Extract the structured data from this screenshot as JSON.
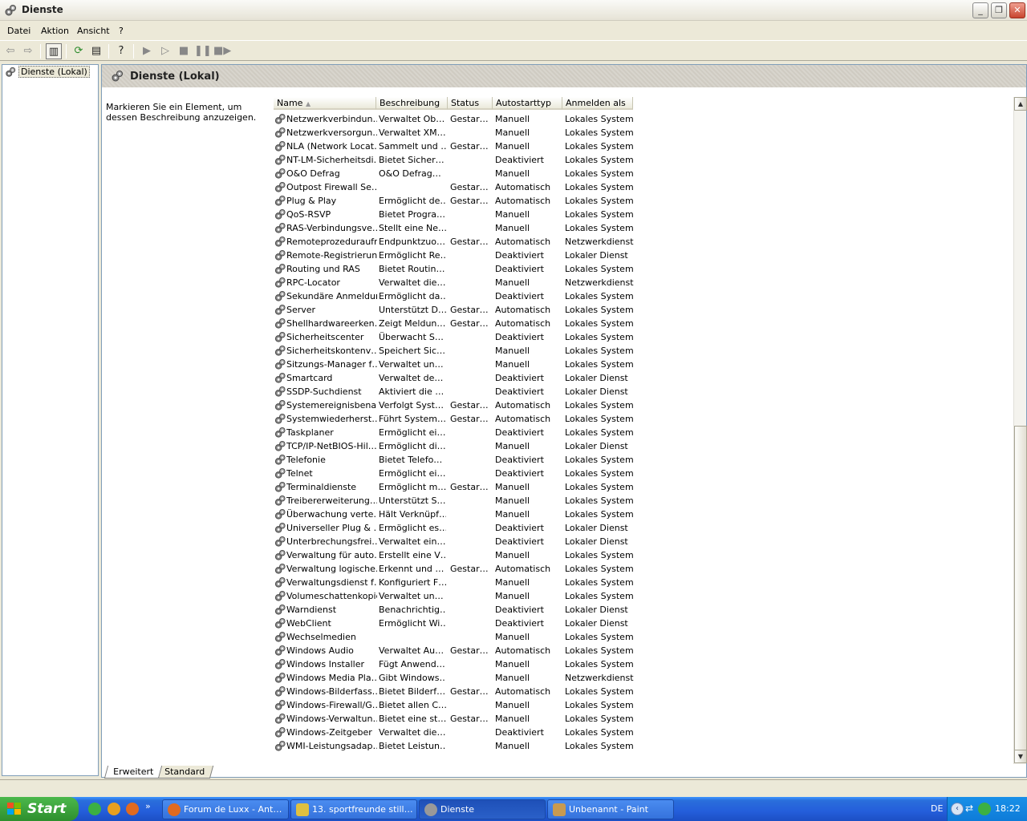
{
  "window": {
    "title": "Dienste",
    "controls": [
      "minimize",
      "maximize",
      "close"
    ]
  },
  "menu": [
    "Datei",
    "Aktion",
    "Ansicht",
    "?"
  ],
  "tree": {
    "root_label": "Dienste (Lokal)"
  },
  "pane": {
    "title": "Dienste (Lokal)",
    "description": "Markieren Sie ein Element, um dessen Beschreibung anzuzeigen."
  },
  "columns": [
    "Name",
    "Beschreibung",
    "Status",
    "Autostarttyp",
    "Anmelden als"
  ],
  "services": [
    [
      "Netzwerkverbindun…",
      "Verwaltet Ob…",
      "Gestar…",
      "Manuell",
      "Lokales System"
    ],
    [
      "Netzwerkversorgun…",
      "Verwaltet XM…",
      "",
      "Manuell",
      "Lokales System"
    ],
    [
      "NLA (Network Locat…",
      "Sammelt und …",
      "Gestar…",
      "Manuell",
      "Lokales System"
    ],
    [
      "NT-LM-Sicherheitsdi…",
      "Bietet Sicher…",
      "",
      "Deaktiviert",
      "Lokales System"
    ],
    [
      "O&O Defrag",
      "O&O Defrag…",
      "",
      "Manuell",
      "Lokales System"
    ],
    [
      "Outpost Firewall Se…",
      "",
      "Gestar…",
      "Automatisch",
      "Lokales System"
    ],
    [
      "Plug & Play",
      "Ermöglicht de…",
      "Gestar…",
      "Automatisch",
      "Lokales System"
    ],
    [
      "QoS-RSVP",
      "Bietet Progra…",
      "",
      "Manuell",
      "Lokales System"
    ],
    [
      "RAS-Verbindungsve…",
      "Stellt eine Ne…",
      "",
      "Manuell",
      "Lokales System"
    ],
    [
      "Remoteprozeduraufr…",
      "Endpunktzuo…",
      "Gestar…",
      "Automatisch",
      "Netzwerkdienst"
    ],
    [
      "Remote-Registrierung",
      "Ermöglicht Re…",
      "",
      "Deaktiviert",
      "Lokaler Dienst"
    ],
    [
      "Routing und RAS",
      "Bietet Routin…",
      "",
      "Deaktiviert",
      "Lokales System"
    ],
    [
      "RPC-Locator",
      "Verwaltet die…",
      "",
      "Manuell",
      "Netzwerkdienst"
    ],
    [
      "Sekundäre Anmeldung",
      "Ermöglicht da…",
      "",
      "Deaktiviert",
      "Lokales System"
    ],
    [
      "Server",
      "Unterstützt D…",
      "Gestar…",
      "Automatisch",
      "Lokales System"
    ],
    [
      "Shellhardwareerken…",
      "Zeigt Meldun…",
      "Gestar…",
      "Automatisch",
      "Lokales System"
    ],
    [
      "Sicherheitscenter",
      "Überwacht S…",
      "",
      "Deaktiviert",
      "Lokales System"
    ],
    [
      "Sicherheitskontenv…",
      "Speichert Sic…",
      "",
      "Manuell",
      "Lokales System"
    ],
    [
      "Sitzungs-Manager f…",
      "Verwaltet un…",
      "",
      "Manuell",
      "Lokales System"
    ],
    [
      "Smartcard",
      "Verwaltet de…",
      "",
      "Deaktiviert",
      "Lokaler Dienst"
    ],
    [
      "SSDP-Suchdienst",
      "Aktiviert die …",
      "",
      "Deaktiviert",
      "Lokaler Dienst"
    ],
    [
      "Systemereignisbena…",
      "Verfolgt Syst…",
      "Gestar…",
      "Automatisch",
      "Lokales System"
    ],
    [
      "Systemwiederherst…",
      "Führt System…",
      "Gestar…",
      "Automatisch",
      "Lokales System"
    ],
    [
      "Taskplaner",
      "Ermöglicht ei…",
      "",
      "Deaktiviert",
      "Lokales System"
    ],
    [
      "TCP/IP-NetBIOS-Hil…",
      "Ermöglicht di…",
      "",
      "Manuell",
      "Lokaler Dienst"
    ],
    [
      "Telefonie",
      "Bietet Telefo…",
      "",
      "Deaktiviert",
      "Lokales System"
    ],
    [
      "Telnet",
      "Ermöglicht ei…",
      "",
      "Deaktiviert",
      "Lokales System"
    ],
    [
      "Terminaldienste",
      "Ermöglicht m…",
      "Gestar…",
      "Manuell",
      "Lokales System"
    ],
    [
      "Treibererweiterung…",
      "Unterstützt S…",
      "",
      "Manuell",
      "Lokales System"
    ],
    [
      "Überwachung verte…",
      "Hält Verknüpf…",
      "",
      "Manuell",
      "Lokales System"
    ],
    [
      "Universeller Plug & …",
      "Ermöglicht es…",
      "",
      "Deaktiviert",
      "Lokaler Dienst"
    ],
    [
      "Unterbrechungsfrei…",
      "Verwaltet ein…",
      "",
      "Deaktiviert",
      "Lokaler Dienst"
    ],
    [
      "Verwaltung für auto…",
      "Erstellt eine V…",
      "",
      "Manuell",
      "Lokales System"
    ],
    [
      "Verwaltung logische…",
      "Erkennt und …",
      "Gestar…",
      "Automatisch",
      "Lokales System"
    ],
    [
      "Verwaltungsdienst f…",
      "Konfiguriert F…",
      "",
      "Manuell",
      "Lokales System"
    ],
    [
      "Volumeschattenkopie",
      "Verwaltet un…",
      "",
      "Manuell",
      "Lokales System"
    ],
    [
      "Warndienst",
      "Benachrichtig…",
      "",
      "Deaktiviert",
      "Lokaler Dienst"
    ],
    [
      "WebClient",
      "Ermöglicht Wi…",
      "",
      "Deaktiviert",
      "Lokaler Dienst"
    ],
    [
      "Wechselmedien",
      "",
      "",
      "Manuell",
      "Lokales System"
    ],
    [
      "Windows Audio",
      "Verwaltet Au…",
      "Gestar…",
      "Automatisch",
      "Lokales System"
    ],
    [
      "Windows Installer",
      "Fügt Anwend…",
      "",
      "Manuell",
      "Lokales System"
    ],
    [
      "Windows Media Pla…",
      "Gibt Windows…",
      "",
      "Manuell",
      "Netzwerkdienst"
    ],
    [
      "Windows-Bilderfass…",
      "Bietet Bilderf…",
      "Gestar…",
      "Automatisch",
      "Lokales System"
    ],
    [
      "Windows-Firewall/G…",
      "Bietet allen C…",
      "",
      "Manuell",
      "Lokales System"
    ],
    [
      "Windows-Verwaltun…",
      "Bietet eine st…",
      "Gestar…",
      "Manuell",
      "Lokales System"
    ],
    [
      "Windows-Zeitgeber",
      "Verwaltet die…",
      "",
      "Deaktiviert",
      "Lokales System"
    ],
    [
      "WMI-Leistungsadap…",
      "Bietet Leistun…",
      "",
      "Manuell",
      "Lokales System"
    ]
  ],
  "tabs": [
    "Erweitert",
    "Standard"
  ],
  "taskbar": {
    "start_label": "Start",
    "tasks": [
      {
        "label": "Forum de Luxx - Ant…",
        "icon": "firefox-icon"
      },
      {
        "label": "13. sportfreunde still…",
        "icon": "pencil-icon"
      },
      {
        "label": "Dienste",
        "icon": "gear-icon"
      },
      {
        "label": "Unbenannt - Paint",
        "icon": "paint-icon"
      }
    ],
    "language": "DE",
    "clock": "18:22"
  },
  "colors": {
    "taskbar": "#245EDB",
    "start": "#3A9E3A",
    "window_bg": "#ECE9D8"
  }
}
